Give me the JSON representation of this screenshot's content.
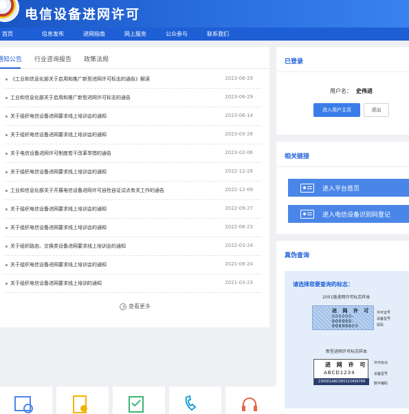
{
  "site": {
    "title": "电信设备进网许可",
    "title_top": ""
  },
  "nav": [
    "首页",
    "信息发布",
    "进网指南",
    "网上服务",
    "公众参与",
    "联系我们"
  ],
  "tabs": [
    "通知公告",
    "行业咨询报告",
    "政策法规"
  ],
  "news": [
    {
      "title": "《工业和信息化部关于启用和推广新型进网许可标志的通告》解读",
      "date": "2023-06-29"
    },
    {
      "title": "工业和信息化部关于启用和推广新型进网许可标志的通告",
      "date": "2023-06-29"
    },
    {
      "title": "关于组织电信设备进网要求线上培训会的通知",
      "date": "2023-06-14"
    },
    {
      "title": "关于组织电信设备进网要求线上培训会的通知",
      "date": "2023-03-28"
    },
    {
      "title": "关于电信设备进网许可制度若干改革举措的通告",
      "date": "2023-02-06"
    },
    {
      "title": "关于组织电信设备进网要求线上培训会的通知",
      "date": "2022-12-28"
    },
    {
      "title": "工业和信息化部关于开展电信设备进网许可自检自证试点有关工作的通告",
      "date": "2022-12-09"
    },
    {
      "title": "关于组织电信设备进网要求线上培训会的通知",
      "date": "2022-09-27"
    },
    {
      "title": "关于组织电信设备进网要求线上培训会的通知",
      "date": "2022-06-23"
    },
    {
      "title": "关于组织路由、交换类设备进网要求线上培训会的通知",
      "date": "2022-03-24"
    },
    {
      "title": "关于组织电信设备进网要求线上培训会的通知",
      "date": "2021-06-24"
    },
    {
      "title": "关于组织电信设备进网要求线上培训的通知",
      "date": "2021-03-23"
    }
  ],
  "more_label": "查看更多",
  "login": {
    "title": "已登录",
    "user_label": "用户名：",
    "user_name": "史伟进",
    "enter_btn": "进入用户主页",
    "logout_btn": "退出"
  },
  "links": {
    "title": "相关链接",
    "items": [
      "进入平台首页",
      "进入电信设备识别码登记"
    ]
  },
  "verify": {
    "title": "真伪查询",
    "prompt": "请选择您要查询的标志：",
    "old_caption": "2001版进网许可标志样本",
    "old_sample_title": "进 网 许 可",
    "old_sample_lines": [
      "000000-000000",
      "000000-000000",
      "00000000"
    ],
    "old_annotations": [
      "许可证号",
      "设备型号",
      "扰码"
    ],
    "new_caption": "新型进网许可标志样本",
    "new_sample_title": "进 网 许 可",
    "new_sample_code": "ABCD1234",
    "new_sample_strip": "230001ABCDE0123456789",
    "new_annotations": [
      "许可标识",
      "设备型号",
      "数字编码"
    ]
  },
  "colors": {
    "brand": "#1e5fd6",
    "banner": "#2b6fe0",
    "link_button": "#4a86e8"
  },
  "bottom_icons": [
    "image-icon",
    "document-icon",
    "checklist-icon",
    "phone-icon",
    "headset-icon"
  ]
}
